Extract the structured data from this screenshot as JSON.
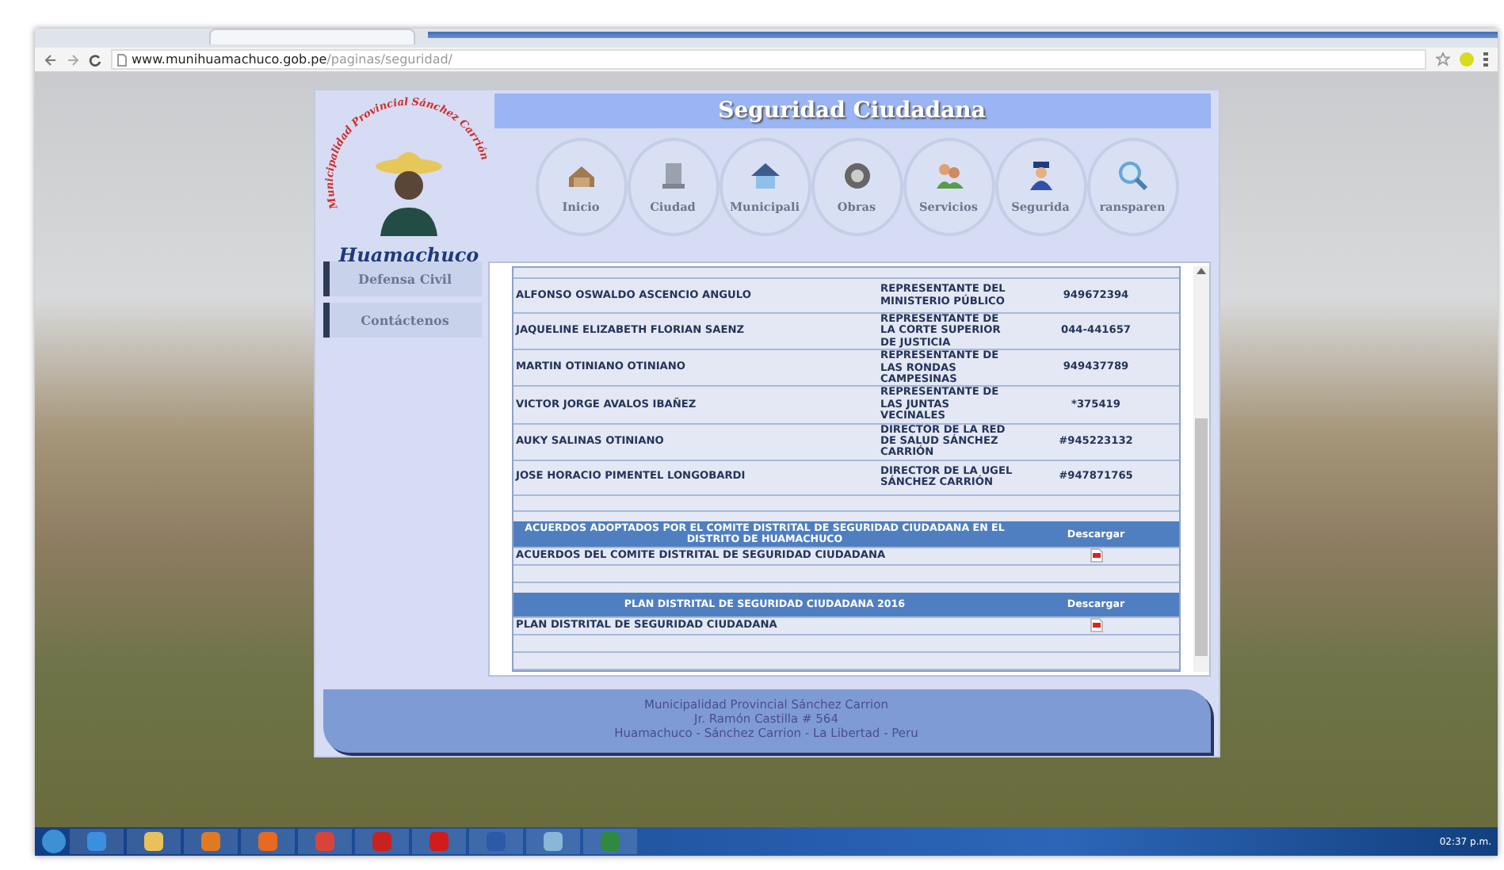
{
  "browser": {
    "url_host": "www.munihuamachuco.gob.pe",
    "url_path": "/paginas/seguridad/"
  },
  "site": {
    "logo": {
      "arc_text": "Municipalidad Provincial Sánchez Carrión",
      "name": "Huamachuco"
    },
    "title": "Seguridad Ciudadana",
    "nav": [
      {
        "label": "Inicio"
      },
      {
        "label": "Ciudad"
      },
      {
        "label": "Municipali"
      },
      {
        "label": "Obras"
      },
      {
        "label": "Servicios"
      },
      {
        "label": "Segurida"
      },
      {
        "label": "ransparen"
      }
    ],
    "sidebar": [
      "Defensa Civil",
      "Contáctenos"
    ],
    "members": [
      {
        "name": "ALFONSO OSWALDO ASCENCIO ANGULO",
        "role": "REPRESENTANTE DEL MINISTERIO PÚBLICO",
        "phone": "949672394"
      },
      {
        "name": "JAQUELINE ELIZABETH FLORIAN SAENZ",
        "role": "REPRESENTANTE DE LA CORTE SUPERIOR DE JUSTICIA",
        "phone": "044-441657"
      },
      {
        "name": "MARTIN OTINIANO OTINIANO",
        "role": "REPRESENTANTE DE LAS RONDAS CAMPESINAS",
        "phone": "949437789"
      },
      {
        "name": "VICTOR JORGE AVALOS IBAÑEZ",
        "role": "REPRESENTANTE DE LAS JUNTAS VECINALES",
        "phone": "*375419"
      },
      {
        "name": "AUKY SALINAS OTINIANO",
        "role": "DIRECTOR DE LA RED DE SALUD SÁNCHEZ CARRIÓN",
        "phone": "#945223132"
      },
      {
        "name": "JOSE HORACIO PIMENTEL LONGOBARDI",
        "role": "DIRECTOR DE LA UGEL SÁNCHEZ CARRIÓN",
        "phone": "#947871765"
      }
    ],
    "documents": [
      {
        "title": "ACUERDOS ADOPTADOS POR EL COMITE DISTRITAL DE SEGURIDAD CIUDADANA EN EL DISTRITO DE HUAMACHUCO",
        "action": "Descargar",
        "rows": [
          "ACUERDOS DEL COMITE DISTRITAL DE SEGURIDAD CIUDADANA"
        ]
      },
      {
        "title": "PLAN DISTRITAL DE SEGURIDAD CIUDADANA 2016",
        "action": "Descargar",
        "rows": [
          "PLAN DISTRITAL DE SEGURIDAD CIUDADANA"
        ]
      }
    ],
    "footer": [
      "Municipalidad Provincial Sánchez Carrion",
      "Jr. Ramón Castilla # 564",
      "Huamachuco - Sánchez Carrion - La Libertad - Peru"
    ]
  },
  "taskbar": {
    "clock": "02:37 p.m."
  }
}
